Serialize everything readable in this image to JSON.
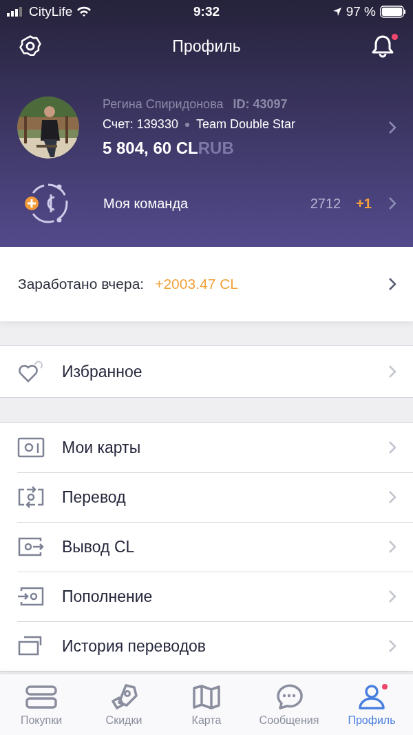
{
  "status_bar": {
    "carrier": "CityLife",
    "time": "9:32",
    "battery": "97 %"
  },
  "header": {
    "title": "Профиль",
    "unread": true
  },
  "profile": {
    "name": "Регина Спиридонова",
    "id": "ID: 43097",
    "account": "Счет: 139330",
    "team": "Team Double Star",
    "balance": "5 804, 60 CL",
    "currency": "RUB"
  },
  "team": {
    "label": "Моя команда",
    "count": "2712",
    "delta": "+1"
  },
  "earned": {
    "label": "Заработано вчера:",
    "value": "+2003.47 CL"
  },
  "favorites": {
    "label": "Избранное"
  },
  "menu": [
    {
      "kind": "cards",
      "label": "Мои карты"
    },
    {
      "kind": "transfer",
      "label": "Перевод"
    },
    {
      "kind": "withdraw",
      "label": "Вывод CL"
    },
    {
      "kind": "topup",
      "label": "Пополнение"
    },
    {
      "kind": "history",
      "label": "История переводов"
    }
  ],
  "tab_bar": [
    {
      "kind": "purchases",
      "label": "Покупки",
      "selected": false,
      "dot": false
    },
    {
      "kind": "discounts",
      "label": "Скидки",
      "selected": false,
      "dot": false
    },
    {
      "kind": "map",
      "label": "Карта",
      "selected": false,
      "dot": false
    },
    {
      "kind": "messages",
      "label": "Сообщения",
      "selected": false,
      "dot": false
    },
    {
      "kind": "profile",
      "label": "Профиль",
      "selected": true,
      "dot": true
    }
  ]
}
